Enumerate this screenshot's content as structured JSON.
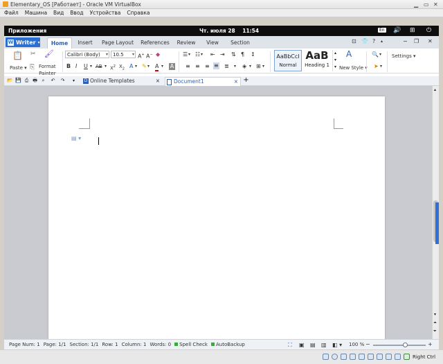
{
  "window": {
    "title": "Elementary_OS [Работает] - Oracle VM VirtualBox",
    "menu": [
      "Файл",
      "Машина",
      "Вид",
      "Ввод",
      "Устройства",
      "Справка"
    ]
  },
  "panel": {
    "apps": "Приложения",
    "date": "Чт. июля 28",
    "time": "11:54",
    "lang": "En"
  },
  "wps": {
    "app_button": "Writer",
    "tabs": [
      "Home",
      "Insert",
      "Page Layout",
      "References",
      "Review",
      "View",
      "Section"
    ],
    "active_tab": "Home",
    "ribbon": {
      "paste": "Paste",
      "format_painter_1": "Format",
      "format_painter_2": "Painter",
      "font": "Calibri (Body)",
      "size": "10.5",
      "style_preview_1": "AaBbCcI",
      "style_name_1": "Normal",
      "style_preview_2": "AaB",
      "style_name_2": "Heading 1",
      "new_style": "New Style",
      "settings": "Settings"
    },
    "doc_tabs": {
      "online_templates": "Online Templates",
      "document": "Document1"
    }
  },
  "status": {
    "page_num": "Page Num: 1",
    "page": "Page: 1/1",
    "section": "Section: 1/1",
    "row": "Row: 1",
    "column": "Column: 1",
    "words": "Words: 0",
    "spell": "Spell Check",
    "autobackup": "AutoBackup",
    "zoom": "100 %",
    "zoom_level": 0.62
  },
  "host_key": "Right Ctrl"
}
